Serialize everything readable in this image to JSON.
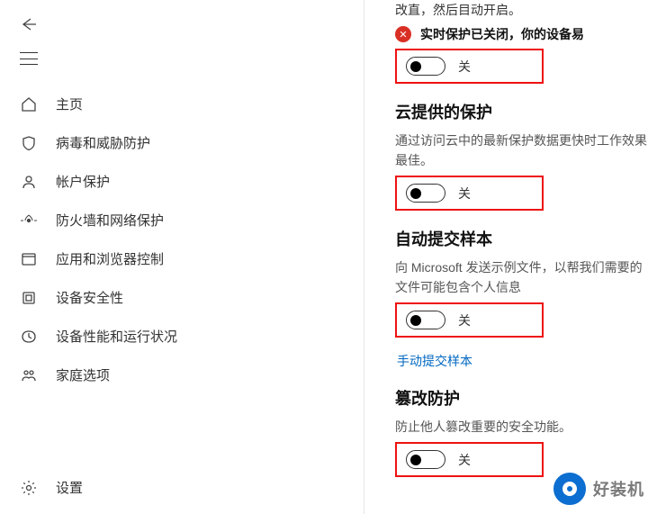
{
  "sidebar": {
    "items": [
      {
        "label": "主页",
        "icon": "home-icon"
      },
      {
        "label": "病毒和威胁防护",
        "icon": "shield-icon"
      },
      {
        "label": "帐户保护",
        "icon": "account-icon"
      },
      {
        "label": "防火墙和网络保护",
        "icon": "firewall-icon"
      },
      {
        "label": "应用和浏览器控制",
        "icon": "app-browser-icon"
      },
      {
        "label": "设备安全性",
        "icon": "device-security-icon"
      },
      {
        "label": "设备性能和运行状况",
        "icon": "performance-icon"
      },
      {
        "label": "家庭选项",
        "icon": "family-icon"
      }
    ],
    "settings_label": "设置"
  },
  "main": {
    "top_partial": "改直，然后目动开启。",
    "realtime_warn": "实时保护已关闭，你的设备易",
    "toggles": {
      "off_label": "关"
    },
    "cloud": {
      "title": "云提供的保护",
      "desc": "通过访问云中的最新保护数据更快时工作效果最佳。"
    },
    "sample": {
      "title": "自动提交样本",
      "desc": "向 Microsoft 发送示例文件，以帮我们需要的文件可能包含个人信息",
      "link": "手动提交样本"
    },
    "tamper": {
      "title": "篡改防护",
      "desc": "防止他人篡改重要的安全功能。"
    }
  },
  "watermark": "好装机"
}
